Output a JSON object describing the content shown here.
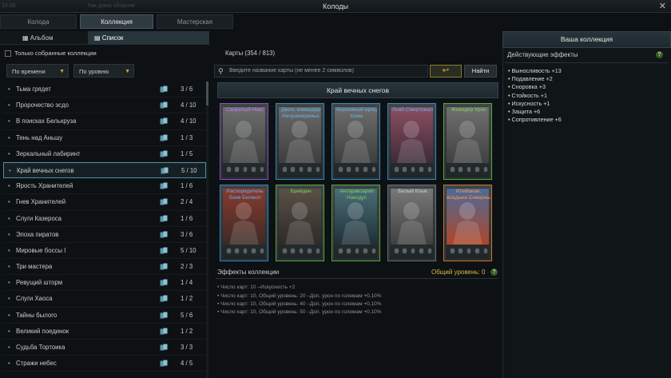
{
  "window": {
    "title": "Колоды",
    "bg_text_left": "15:08",
    "bg_text_mid": "Как дома обороне",
    "close_glyph": "✕"
  },
  "tabs": [
    {
      "label": "Колода"
    },
    {
      "label": "Коллекция"
    },
    {
      "label": "Мастерская"
    }
  ],
  "view_toggle": {
    "album": "Альбом",
    "list": "Список"
  },
  "only_collected": "Только собранные коллекции",
  "sort": {
    "by_time": "По времени",
    "by_level": "По уровню"
  },
  "card_count": "Карты (354 / 813)",
  "search": {
    "placeholder": "Введите название карты (не менее 2 символов)",
    "find_label": "Найти",
    "reset_glyph": "↩"
  },
  "sets": [
    {
      "name": "Тьма грядет",
      "count": "3 / 6"
    },
    {
      "name": "Пророчество эсдо",
      "count": "4 / 10"
    },
    {
      "name": "В поисках Белькруза",
      "count": "4 / 10"
    },
    {
      "name": "Тень над Аньшу",
      "count": "1 / 3"
    },
    {
      "name": "Зеркальный лабиринт",
      "count": "1 / 5"
    },
    {
      "name": "Край вечных снегов",
      "count": "5 / 10"
    },
    {
      "name": "Ярость Хранителей",
      "count": "1 / 6"
    },
    {
      "name": "Гнев Хранителей",
      "count": "2 / 4"
    },
    {
      "name": "Слуги Казероса",
      "count": "1 / 6"
    },
    {
      "name": "Эпоха пиратов",
      "count": "3 / 6"
    },
    {
      "name": "Мировые боссы I",
      "count": "5 / 10"
    },
    {
      "name": "Три мастера",
      "count": "2 / 3"
    },
    {
      "name": "Ревущий шторм",
      "count": "1 / 4"
    },
    {
      "name": "Слуги Хаоса",
      "count": "1 / 2"
    },
    {
      "name": "Тайны былого",
      "count": "5 / 6"
    },
    {
      "name": "Великий поединок",
      "count": "1 / 2"
    },
    {
      "name": "Судьба Тортоика",
      "count": "3 / 3"
    },
    {
      "name": "Стражи небес",
      "count": "4 / 5"
    }
  ],
  "selected_set": "Край вечных снегов",
  "cards": [
    {
      "name": "Свирепый Накс",
      "rarity": "purple",
      "owned": false
    },
    {
      "name": "Джон, командир Непримиримых",
      "rarity": "blue",
      "owned": false
    },
    {
      "name": "Верховный жрец Кома",
      "rarity": "blue",
      "owned": false
    },
    {
      "name": "Лоаб Смертожал",
      "rarity": "blue",
      "owned": true
    },
    {
      "name": "Живодер Урох",
      "rarity": "green",
      "owned": false
    },
    {
      "name": "Распорядитель боев Белмоп",
      "rarity": "blue",
      "owned": true
    },
    {
      "name": "Брейден",
      "rarity": "green",
      "owned": true
    },
    {
      "name": "Антараксарий Накодус",
      "rarity": "green",
      "owned": true
    },
    {
      "name": "Белый Клык",
      "rarity": "grey",
      "owned": false
    },
    {
      "name": "Илийакан, владыка Северны",
      "rarity": "orange",
      "owned": true
    }
  ],
  "collection_effects": {
    "title": "Эффекты коллекции",
    "level": "Общий уровень: 0",
    "lines": [
      "• Число карт: 10 –Искусность +2",
      "• Число карт: 10, Общий уровень: 20 –Доп. урон по големам +0,10%",
      "• Число карт: 10, Общий уровень: 40 –Доп. урон по големам +0,10%",
      "• Число карт: 10, Общий уровень: 50 –Доп. урон по големам +0,10%"
    ]
  },
  "right_panel": {
    "title": "Ваша коллекция",
    "subtitle": "Действующие эффекты",
    "effects": [
      "• Выносливость +13",
      "• Подавление +2",
      "• Сноровка +3",
      "• Стойкость +1",
      "• Искусность +1",
      "• Защита +6",
      "• Сопротивление +6"
    ]
  },
  "colors": {
    "accent_gold": "#d3a23a",
    "rarity_blue": "#2f8ec9",
    "rarity_green": "#5cae3a",
    "rarity_purple": "#8f4fc9",
    "rarity_orange": "#d27a2a"
  }
}
